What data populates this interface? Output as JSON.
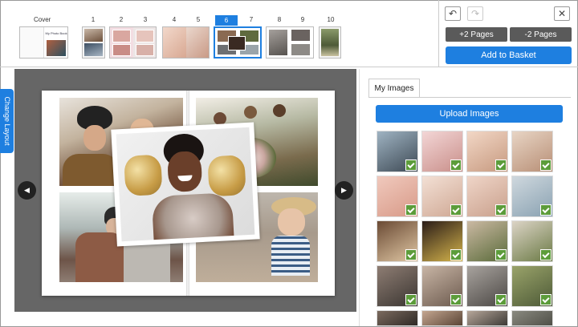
{
  "toolbar": {
    "undo_icon": "undo-icon",
    "redo_icon": "redo-icon",
    "close_icon": "close-icon",
    "close_glyph": "✕",
    "undo_glyph": "↶",
    "redo_glyph": "↷",
    "add_pages_label": "+2 Pages",
    "remove_pages_label": "-2 Pages",
    "basket_label": "Add to Basket"
  },
  "pages": {
    "cover_label": "Cover",
    "labels": [
      "1",
      "2",
      "3",
      "4",
      "5",
      "6",
      "7",
      "8",
      "9",
      "10"
    ],
    "active_label": "6",
    "cover_book_title": "My Photo Book"
  },
  "editor": {
    "change_layout_label": "Change Layout",
    "prev_glyph": "◀",
    "next_glyph": "▶"
  },
  "sidebar": {
    "tab_label": "My Images",
    "upload_label": "Upload Images"
  },
  "colors": {
    "accent": "#1e7fe0",
    "check": "#5c9c3a",
    "gray_button": "#5a5a5a",
    "canvas": "#666666"
  }
}
